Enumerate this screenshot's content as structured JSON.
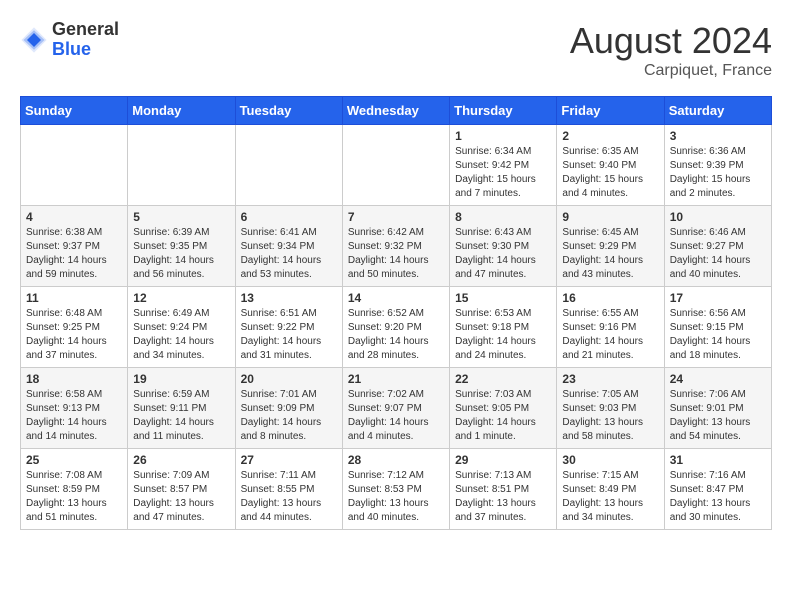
{
  "header": {
    "logo_general": "General",
    "logo_blue": "Blue",
    "month_year": "August 2024",
    "location": "Carpiquet, France"
  },
  "weekdays": [
    "Sunday",
    "Monday",
    "Tuesday",
    "Wednesday",
    "Thursday",
    "Friday",
    "Saturday"
  ],
  "weeks": [
    [
      {
        "day": "",
        "info": ""
      },
      {
        "day": "",
        "info": ""
      },
      {
        "day": "",
        "info": ""
      },
      {
        "day": "",
        "info": ""
      },
      {
        "day": "1",
        "info": "Sunrise: 6:34 AM\nSunset: 9:42 PM\nDaylight: 15 hours\nand 7 minutes."
      },
      {
        "day": "2",
        "info": "Sunrise: 6:35 AM\nSunset: 9:40 PM\nDaylight: 15 hours\nand 4 minutes."
      },
      {
        "day": "3",
        "info": "Sunrise: 6:36 AM\nSunset: 9:39 PM\nDaylight: 15 hours\nand 2 minutes."
      }
    ],
    [
      {
        "day": "4",
        "info": "Sunrise: 6:38 AM\nSunset: 9:37 PM\nDaylight: 14 hours\nand 59 minutes."
      },
      {
        "day": "5",
        "info": "Sunrise: 6:39 AM\nSunset: 9:35 PM\nDaylight: 14 hours\nand 56 minutes."
      },
      {
        "day": "6",
        "info": "Sunrise: 6:41 AM\nSunset: 9:34 PM\nDaylight: 14 hours\nand 53 minutes."
      },
      {
        "day": "7",
        "info": "Sunrise: 6:42 AM\nSunset: 9:32 PM\nDaylight: 14 hours\nand 50 minutes."
      },
      {
        "day": "8",
        "info": "Sunrise: 6:43 AM\nSunset: 9:30 PM\nDaylight: 14 hours\nand 47 minutes."
      },
      {
        "day": "9",
        "info": "Sunrise: 6:45 AM\nSunset: 9:29 PM\nDaylight: 14 hours\nand 43 minutes."
      },
      {
        "day": "10",
        "info": "Sunrise: 6:46 AM\nSunset: 9:27 PM\nDaylight: 14 hours\nand 40 minutes."
      }
    ],
    [
      {
        "day": "11",
        "info": "Sunrise: 6:48 AM\nSunset: 9:25 PM\nDaylight: 14 hours\nand 37 minutes."
      },
      {
        "day": "12",
        "info": "Sunrise: 6:49 AM\nSunset: 9:24 PM\nDaylight: 14 hours\nand 34 minutes."
      },
      {
        "day": "13",
        "info": "Sunrise: 6:51 AM\nSunset: 9:22 PM\nDaylight: 14 hours\nand 31 minutes."
      },
      {
        "day": "14",
        "info": "Sunrise: 6:52 AM\nSunset: 9:20 PM\nDaylight: 14 hours\nand 28 minutes."
      },
      {
        "day": "15",
        "info": "Sunrise: 6:53 AM\nSunset: 9:18 PM\nDaylight: 14 hours\nand 24 minutes."
      },
      {
        "day": "16",
        "info": "Sunrise: 6:55 AM\nSunset: 9:16 PM\nDaylight: 14 hours\nand 21 minutes."
      },
      {
        "day": "17",
        "info": "Sunrise: 6:56 AM\nSunset: 9:15 PM\nDaylight: 14 hours\nand 18 minutes."
      }
    ],
    [
      {
        "day": "18",
        "info": "Sunrise: 6:58 AM\nSunset: 9:13 PM\nDaylight: 14 hours\nand 14 minutes."
      },
      {
        "day": "19",
        "info": "Sunrise: 6:59 AM\nSunset: 9:11 PM\nDaylight: 14 hours\nand 11 minutes."
      },
      {
        "day": "20",
        "info": "Sunrise: 7:01 AM\nSunset: 9:09 PM\nDaylight: 14 hours\nand 8 minutes."
      },
      {
        "day": "21",
        "info": "Sunrise: 7:02 AM\nSunset: 9:07 PM\nDaylight: 14 hours\nand 4 minutes."
      },
      {
        "day": "22",
        "info": "Sunrise: 7:03 AM\nSunset: 9:05 PM\nDaylight: 14 hours\nand 1 minute."
      },
      {
        "day": "23",
        "info": "Sunrise: 7:05 AM\nSunset: 9:03 PM\nDaylight: 13 hours\nand 58 minutes."
      },
      {
        "day": "24",
        "info": "Sunrise: 7:06 AM\nSunset: 9:01 PM\nDaylight: 13 hours\nand 54 minutes."
      }
    ],
    [
      {
        "day": "25",
        "info": "Sunrise: 7:08 AM\nSunset: 8:59 PM\nDaylight: 13 hours\nand 51 minutes."
      },
      {
        "day": "26",
        "info": "Sunrise: 7:09 AM\nSunset: 8:57 PM\nDaylight: 13 hours\nand 47 minutes."
      },
      {
        "day": "27",
        "info": "Sunrise: 7:11 AM\nSunset: 8:55 PM\nDaylight: 13 hours\nand 44 minutes."
      },
      {
        "day": "28",
        "info": "Sunrise: 7:12 AM\nSunset: 8:53 PM\nDaylight: 13 hours\nand 40 minutes."
      },
      {
        "day": "29",
        "info": "Sunrise: 7:13 AM\nSunset: 8:51 PM\nDaylight: 13 hours\nand 37 minutes."
      },
      {
        "day": "30",
        "info": "Sunrise: 7:15 AM\nSunset: 8:49 PM\nDaylight: 13 hours\nand 34 minutes."
      },
      {
        "day": "31",
        "info": "Sunrise: 7:16 AM\nSunset: 8:47 PM\nDaylight: 13 hours\nand 30 minutes."
      }
    ]
  ]
}
